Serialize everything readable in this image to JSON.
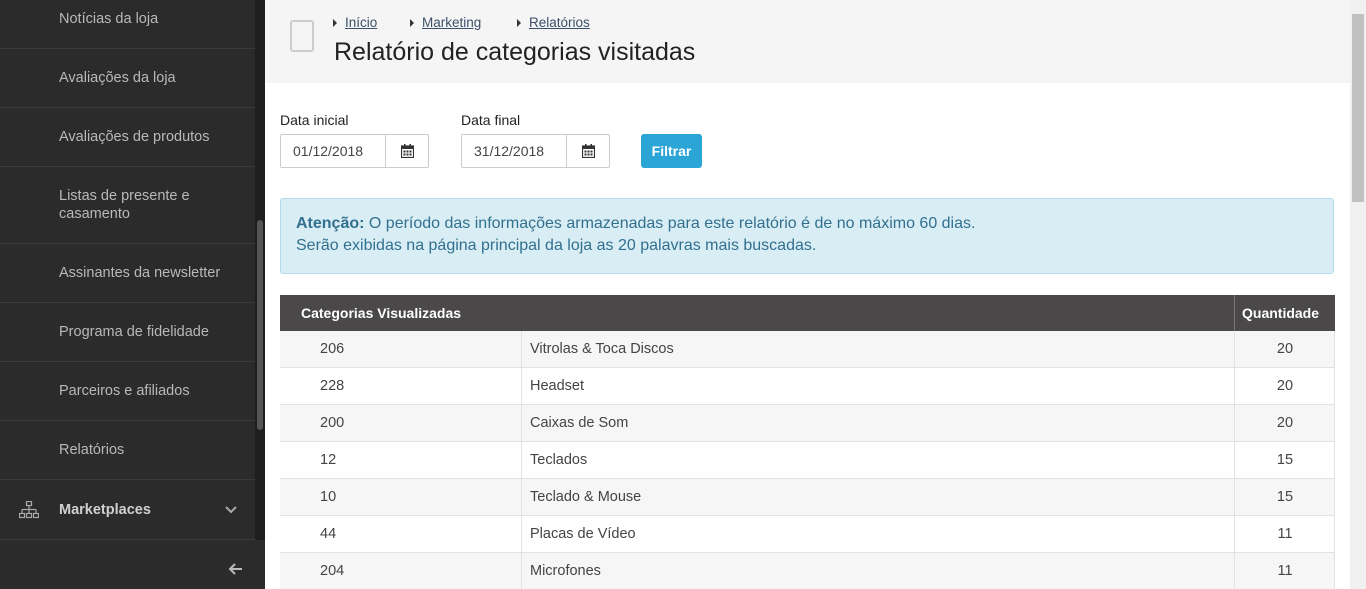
{
  "sidebar": {
    "items": [
      {
        "label": "Notícias da loja"
      },
      {
        "label": "Avaliações da loja"
      },
      {
        "label": "Avaliações de produtos"
      },
      {
        "label": "Listas de presente e casamento"
      },
      {
        "label": "Assinantes da newsletter"
      },
      {
        "label": "Programa de fidelidade"
      },
      {
        "label": "Parceiros e afiliados"
      },
      {
        "label": "Relatórios"
      }
    ],
    "marketplaces_label": "Marketplaces"
  },
  "breadcrumb": [
    "Início",
    "Marketing",
    "Relatórios"
  ],
  "page_title": "Relatório de categorias visitadas",
  "filters": {
    "start_label": "Data inicial",
    "start_value": "01/12/2018",
    "end_label": "Data final",
    "end_value": "31/12/2018",
    "filter_button": "Filtrar"
  },
  "alert": {
    "strong": "Atenção:",
    "line1": " O período das informações armazenadas para este relatório é de no máximo 60 dias.",
    "line2": "Serão exibidas na página principal da loja as 20 palavras mais buscadas."
  },
  "table": {
    "headers": [
      "Categorias Visualizadas",
      "Quantidade"
    ],
    "rows": [
      {
        "id": "206",
        "name": "Vitrolas & Toca Discos",
        "qty": "20"
      },
      {
        "id": "228",
        "name": "Headset",
        "qty": "20"
      },
      {
        "id": "200",
        "name": "Caixas de Som",
        "qty": "20"
      },
      {
        "id": "12",
        "name": "Teclados",
        "qty": "15"
      },
      {
        "id": "10",
        "name": "Teclado & Mouse",
        "qty": "15"
      },
      {
        "id": "44",
        "name": "Placas de Vídeo",
        "qty": "11"
      },
      {
        "id": "204",
        "name": "Microfones",
        "qty": "11"
      }
    ]
  },
  "colors": {
    "sidebar_bg": "#2b2b2b",
    "accent": "#2aa5d6",
    "alert_bg": "#d9edf4",
    "alert_text": "#31708f",
    "table_header_bg": "#4a4848"
  }
}
